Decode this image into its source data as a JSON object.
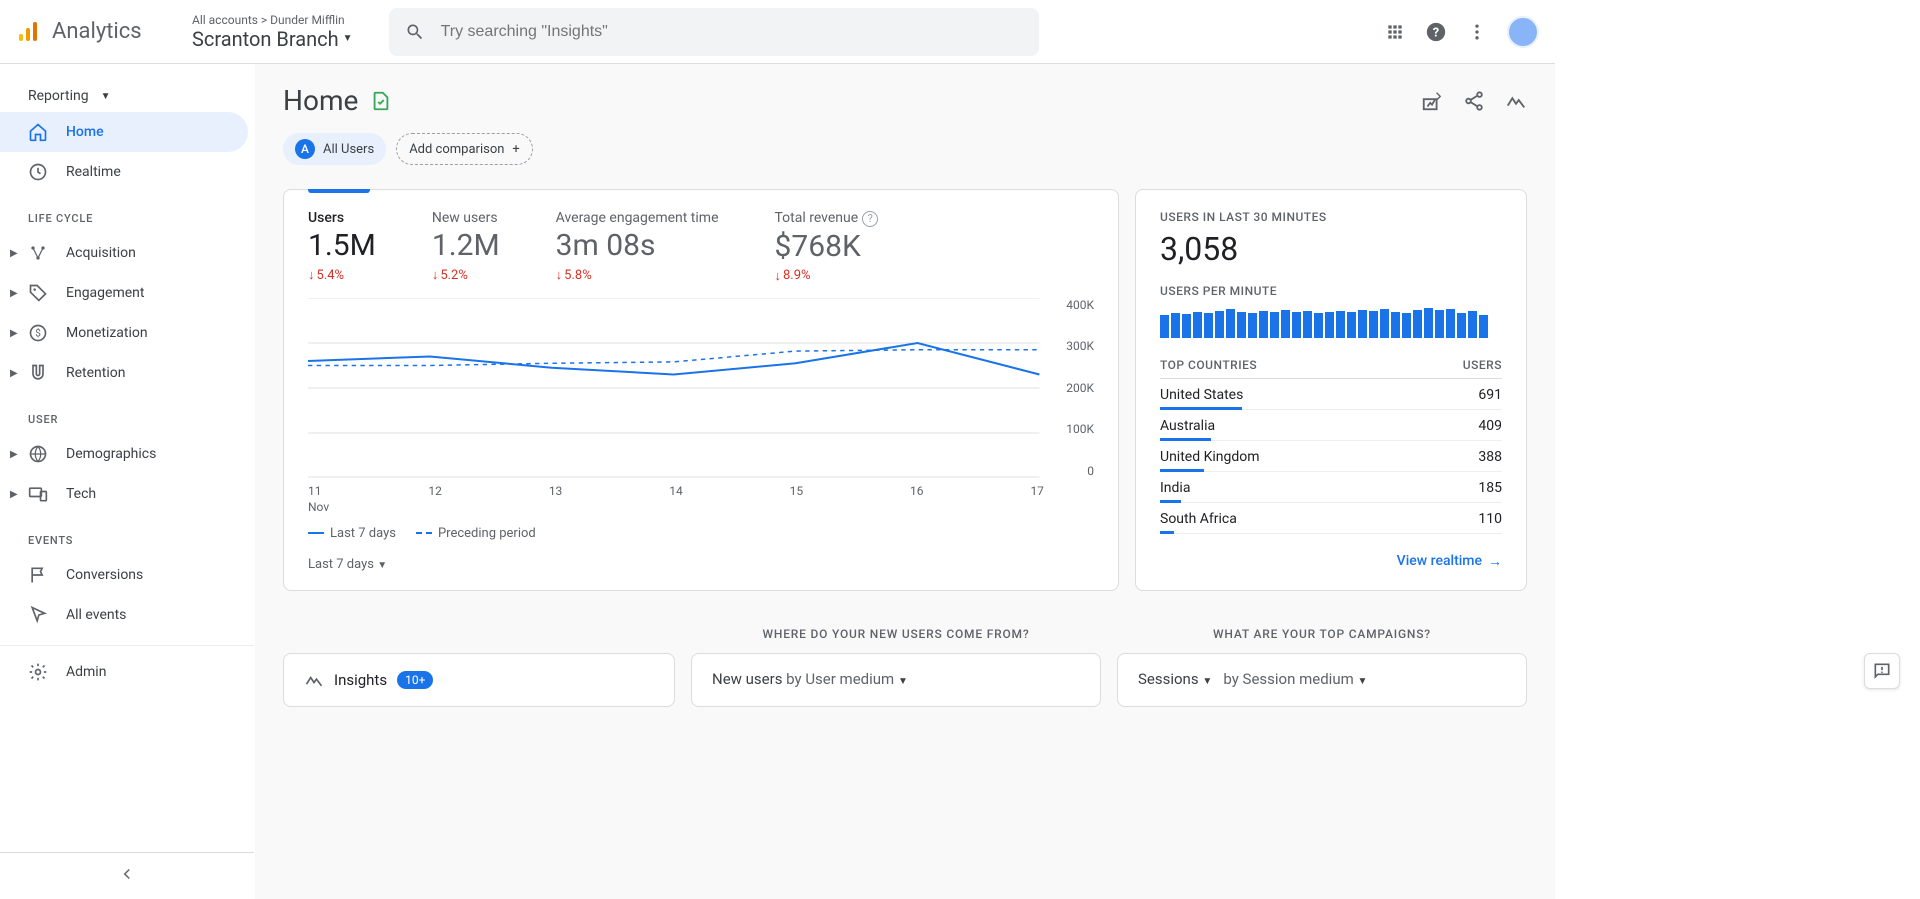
{
  "header": {
    "product": "Analytics",
    "breadcrumb": "All accounts > Dunder Mifflin",
    "property": "Scranton Branch",
    "search_placeholder": "Try searching \"Insights\""
  },
  "sidebar": {
    "reporting_label": "Reporting",
    "sections": {
      "life_cycle": "LIFE CYCLE",
      "user": "USER",
      "events": "EVENTS"
    },
    "items": {
      "home": "Home",
      "realtime": "Realtime",
      "acquisition": "Acquisition",
      "engagement": "Engagement",
      "monetization": "Monetization",
      "retention": "Retention",
      "demographics": "Demographics",
      "tech": "Tech",
      "conversions": "Conversions",
      "all_events": "All events",
      "admin": "Admin"
    }
  },
  "page": {
    "title": "Home",
    "all_users": "All Users",
    "all_users_badge": "A",
    "add_comparison": "Add comparison"
  },
  "overview": {
    "metrics": [
      {
        "label": "Users",
        "value": "1.5M",
        "delta": "5.4%"
      },
      {
        "label": "New users",
        "value": "1.2M",
        "delta": "5.2%"
      },
      {
        "label": "Average engagement time",
        "value": "3m 08s",
        "delta": "5.8%"
      },
      {
        "label": "Total revenue",
        "value": "$768K",
        "delta": "8.9%"
      }
    ],
    "legend_current": "Last 7 days",
    "legend_prev": "Preceding period",
    "x_sublabel": "Nov",
    "range_selector": "Last 7 days"
  },
  "chart_data": {
    "type": "line",
    "title": "Users",
    "ylabel": "",
    "xlabel": "",
    "ylim": [
      0,
      400000
    ],
    "y_ticks": [
      "400K",
      "300K",
      "200K",
      "100K",
      "0"
    ],
    "x": [
      "11",
      "12",
      "13",
      "14",
      "15",
      "16",
      "17"
    ],
    "series": [
      {
        "name": "Last 7 days",
        "values": [
          260000,
          270000,
          245000,
          230000,
          255000,
          300000,
          230000
        ]
      },
      {
        "name": "Preceding period",
        "values": [
          250000,
          250000,
          255000,
          258000,
          282000,
          285000,
          285000
        ]
      }
    ]
  },
  "realtime": {
    "title": "USERS IN LAST 30 MINUTES",
    "value": "3,058",
    "per_minute_label": "USERS PER MINUTE",
    "spark": [
      22,
      24,
      23,
      25,
      24,
      26,
      28,
      25,
      24,
      26,
      25,
      27,
      25,
      26,
      24,
      25,
      26,
      25,
      27,
      26,
      28,
      25,
      24,
      27,
      29,
      27,
      28,
      24,
      26,
      22
    ],
    "table_head_left": "TOP COUNTRIES",
    "table_head_right": "USERS",
    "rows": [
      {
        "country": "United States",
        "users": "691",
        "pct": 24
      },
      {
        "country": "Australia",
        "users": "409",
        "pct": 15
      },
      {
        "country": "United Kingdom",
        "users": "388",
        "pct": 13
      },
      {
        "country": "India",
        "users": "185",
        "pct": 6
      },
      {
        "country": "South Africa",
        "users": "110",
        "pct": 4
      }
    ],
    "footer_link": "View realtime"
  },
  "sections": {
    "new_users_head": "WHERE DO YOUR NEW USERS COME FROM?",
    "campaigns_head": "WHAT ARE YOUR TOP CAMPAIGNS?"
  },
  "bottom": {
    "insights_label": "Insights",
    "insights_badge": "10+",
    "new_users_title_a": "New users ",
    "new_users_title_b": "by User medium",
    "sessions_title_a": "Sessions",
    "sessions_title_b": "by Session medium"
  }
}
